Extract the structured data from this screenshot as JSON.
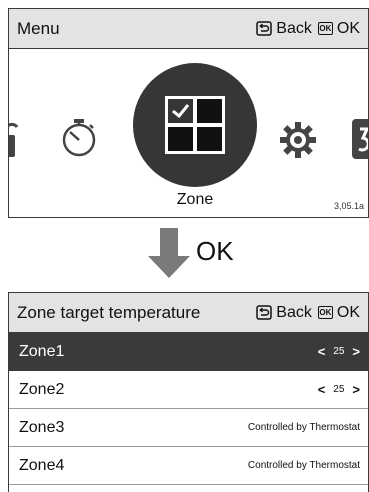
{
  "menu_screen": {
    "title": "Menu",
    "back_label": "Back",
    "ok_icon_text": "OK",
    "ok_label": "OK",
    "selected_label": "Zone",
    "version": "3,05.1a",
    "icons": [
      "lock-icon",
      "timer-icon",
      "zone-grid-icon",
      "gear-icon",
      "number-icon"
    ]
  },
  "transition": {
    "label": "OK"
  },
  "zone_screen": {
    "title": "Zone target temperature",
    "back_label": "Back",
    "ok_icon_text": "OK",
    "ok_label": "OK",
    "rows": [
      {
        "name": "Zone1",
        "value": "25",
        "selected": true
      },
      {
        "name": "Zone2",
        "value": "25",
        "selected": false
      },
      {
        "name": "Zone3",
        "status": "Controlled by Thermostat"
      },
      {
        "name": "Zone4",
        "status": "Controlled by Thermostat"
      }
    ]
  },
  "colors": {
    "header_bg": "#e3e3e3",
    "selected_bg": "#3a3a3a",
    "arrow": "#7a7a7a"
  }
}
